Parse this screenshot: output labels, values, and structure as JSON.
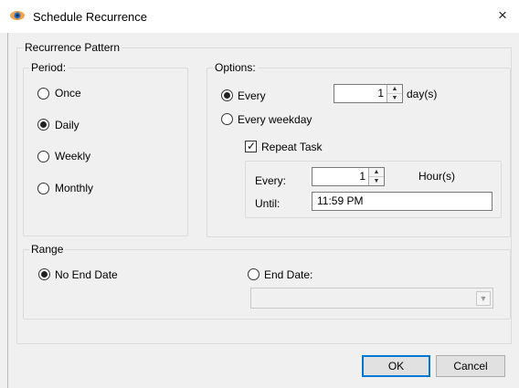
{
  "window": {
    "title": "Schedule Recurrence",
    "close_glyph": "×",
    "app_icon": "eye-icon"
  },
  "recurrence_pattern": {
    "label": "Recurrence Pattern",
    "period": {
      "label": "Period:",
      "options": [
        "Once",
        "Daily",
        "Weekly",
        "Monthly"
      ],
      "selected": "Daily"
    },
    "options": {
      "label": "Options:",
      "every_label": "Every",
      "every_value": "1",
      "every_unit": "day(s)",
      "every_weekday_label": "Every weekday",
      "selected": "Every",
      "repeat_task": {
        "label": "Repeat Task",
        "checked": true,
        "every_label": "Every:",
        "every_value": "1",
        "unit": "Hour(s)",
        "until_label": "Until:",
        "until_value": "11:59 PM"
      }
    }
  },
  "range": {
    "label": "Range",
    "no_end_date_label": "No End Date",
    "end_date_label": "End Date:",
    "selected": "No End Date",
    "end_date_value": ""
  },
  "buttons": {
    "ok": "OK",
    "cancel": "Cancel"
  },
  "colors": {
    "dialog_bg": "#f0f0f0",
    "title_bg": "#ffffff",
    "focus_border": "#0078d7"
  }
}
